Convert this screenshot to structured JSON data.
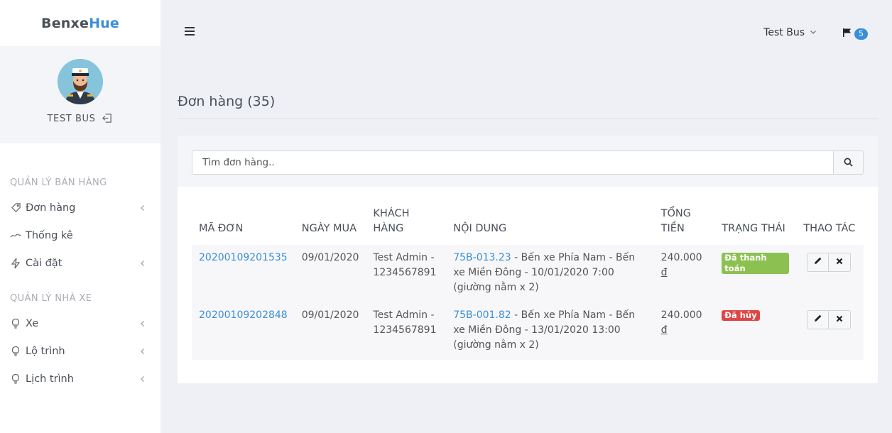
{
  "brand": {
    "part1": "Benxe",
    "part2": "Hue"
  },
  "profile": {
    "name": "TEST BUS"
  },
  "sidebar": {
    "sections": [
      {
        "title": "QUẢN LÝ BÁN HÀNG",
        "items": [
          {
            "label": "Đơn hàng",
            "icon": "tag-icon",
            "has_chevron": true
          },
          {
            "label": "Thống kê",
            "icon": "chart-icon",
            "has_chevron": false
          },
          {
            "label": "Cài đặt",
            "icon": "bolt-icon",
            "has_chevron": true
          }
        ]
      },
      {
        "title": "QUẢN LÝ NHÀ XE",
        "items": [
          {
            "label": "Xe",
            "icon": "bulb-icon",
            "has_chevron": true
          },
          {
            "label": "Lộ trình",
            "icon": "bulb-icon",
            "has_chevron": true
          },
          {
            "label": "Lịch trình",
            "icon": "bulb-icon",
            "has_chevron": true
          }
        ]
      }
    ]
  },
  "topbar": {
    "user": "Test Bus",
    "notification_count": "5"
  },
  "page": {
    "title": "Đơn hàng (35)"
  },
  "search": {
    "placeholder": "Tìm đơn hàng.."
  },
  "table": {
    "headers": {
      "code": "MÃ ĐƠN",
      "date": "NGÀY MUA",
      "customer_1": "KHÁCH",
      "customer_2": "HÀNG",
      "content": "NỘI DUNG",
      "total_1": "TỔNG",
      "total_2": "TIỀN",
      "status": "TRẠNG THÁI",
      "actions": "THAO TÁC"
    },
    "rows": [
      {
        "code": "20200109201535",
        "date": "09/01/2020",
        "customer_name": "Test Admin -",
        "customer_phone": "1234567891",
        "plate": "75B-013.23",
        "content_rest": " - Bến xe Phía Nam - Bến xe Miền Đông - 10/01/2020 7:00 (giường nằm x 2)",
        "amount": "240.000",
        "currency": "đ",
        "status": "Đã thanh toán",
        "status_color": "#8cc152"
      },
      {
        "code": "20200109202848",
        "date": "09/01/2020",
        "customer_name": "Test Admin -",
        "customer_phone": "1234567891",
        "plate": "75B-001.82",
        "content_rest": " - Bến xe Phía Nam - Bến xe Miền Đông - 13/01/2020 13:00 (giường nằm x 2)",
        "amount": "240.000",
        "currency": "đ",
        "status": "Đã hủy",
        "status_color": "#e04545"
      }
    ]
  },
  "colors": {
    "accent": "#3a8fd8",
    "paid": "#8cc152",
    "cancelled": "#e04545"
  }
}
